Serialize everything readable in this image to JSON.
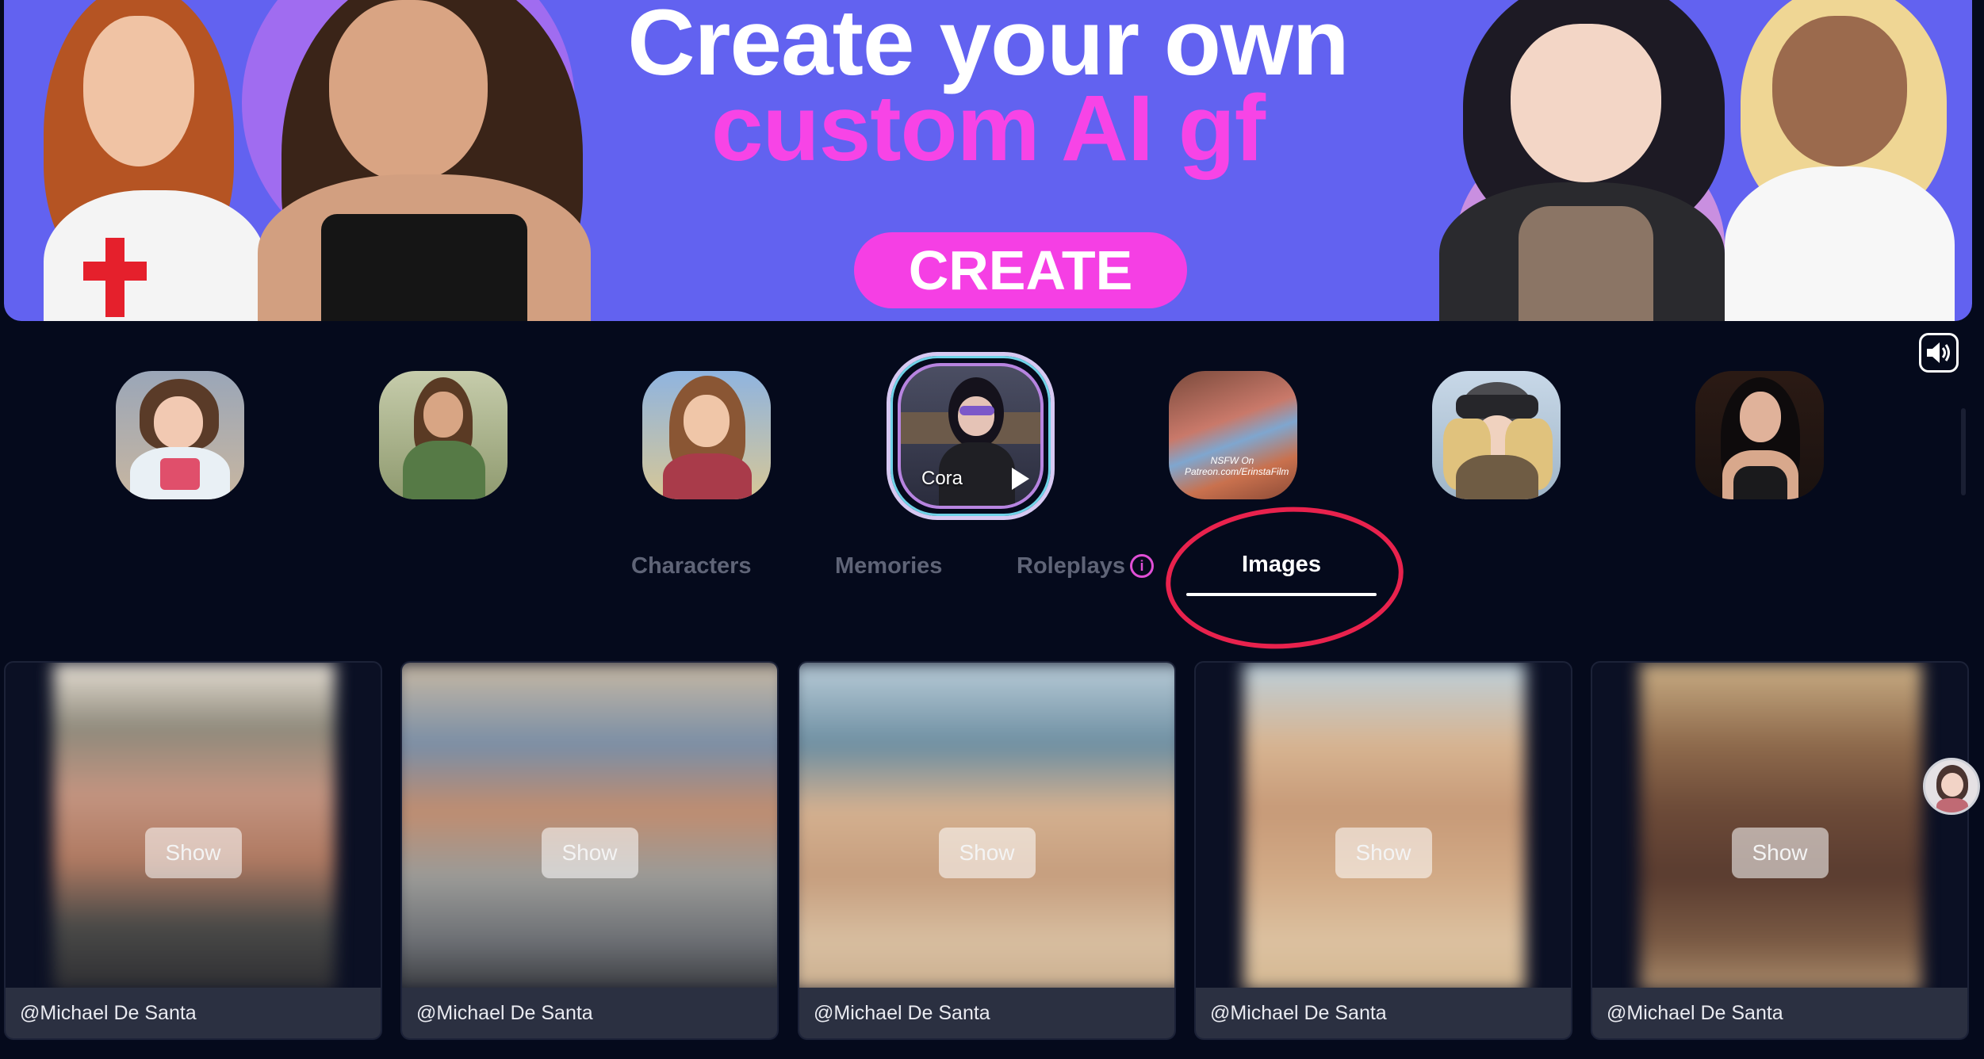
{
  "banner": {
    "headline_line1": "Create your own",
    "headline_line2": "custom AI gf",
    "create_label": "CREATE"
  },
  "avatars": [
    {
      "name": "mei-avatar"
    },
    {
      "name": "lara-avatar"
    },
    {
      "name": "aerith-avatar"
    },
    {
      "name": "cora-avatar",
      "label": "Cora",
      "active": true
    },
    {
      "name": "nsfw-avatar",
      "caption": "NSFW On Patreon.com/ErinstaFilm"
    },
    {
      "name": "soldier-avatar"
    },
    {
      "name": "brunette-avatar"
    }
  ],
  "tabs": {
    "characters": "Characters",
    "memories": "Memories",
    "roleplays": "Roleplays",
    "images": "Images",
    "active": "Images"
  },
  "grid": {
    "show_label": "Show",
    "cards": [
      {
        "author": "@Michael De Santa"
      },
      {
        "author": "@Michael De Santa"
      },
      {
        "author": "@Michael De Santa"
      },
      {
        "author": "@Michael De Santa"
      },
      {
        "author": "@Michael De Santa"
      }
    ]
  },
  "colors": {
    "background": "#050a1c",
    "banner": "#6262f0",
    "accent_pink": "#f53fe4",
    "highlight_red": "#e9224d"
  },
  "icons": [
    "volume-icon",
    "info-icon",
    "play-icon"
  ]
}
